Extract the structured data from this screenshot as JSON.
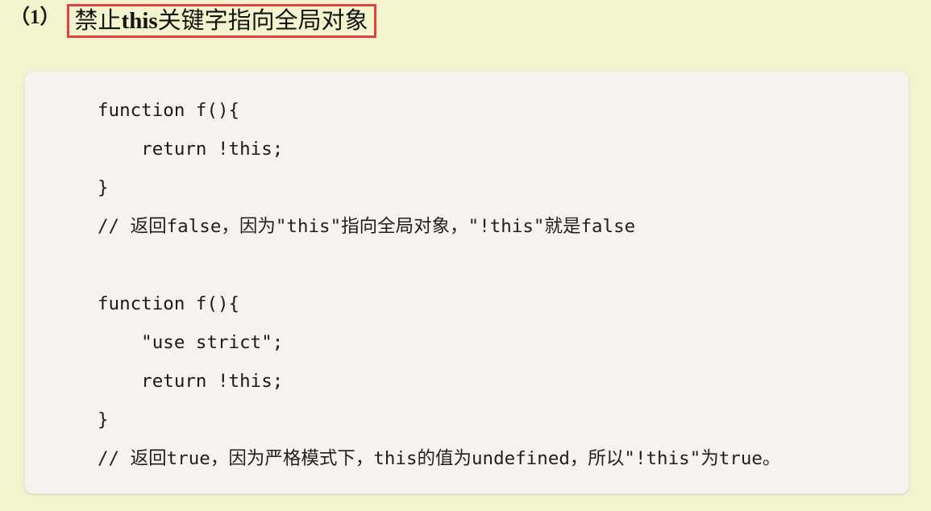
{
  "heading": {
    "number": "（1）",
    "text_prefix": "禁止",
    "keyword": "this",
    "text_suffix": "关键字指向全局对象",
    "full_text": "禁止this关键字指向全局对象",
    "box_border_color": "#e04040"
  },
  "colors": {
    "page_background": "#f3f3cd",
    "code_background": "#f7f2f0",
    "code_text": "#1a1a1a",
    "heading_text": "#141414",
    "highlight_border": "#e04040"
  },
  "code_block": {
    "language": "javascript",
    "lines": [
      "function f(){",
      "    return !this;",
      "}",
      "// 返回false，因为\"this\"指向全局对象，\"!this\"就是false",
      "",
      "function f(){",
      "    \"use strict\";",
      "    return !this;",
      "}",
      "// 返回true，因为严格模式下，this的值为undefined，所以\"!this\"为true。"
    ]
  }
}
